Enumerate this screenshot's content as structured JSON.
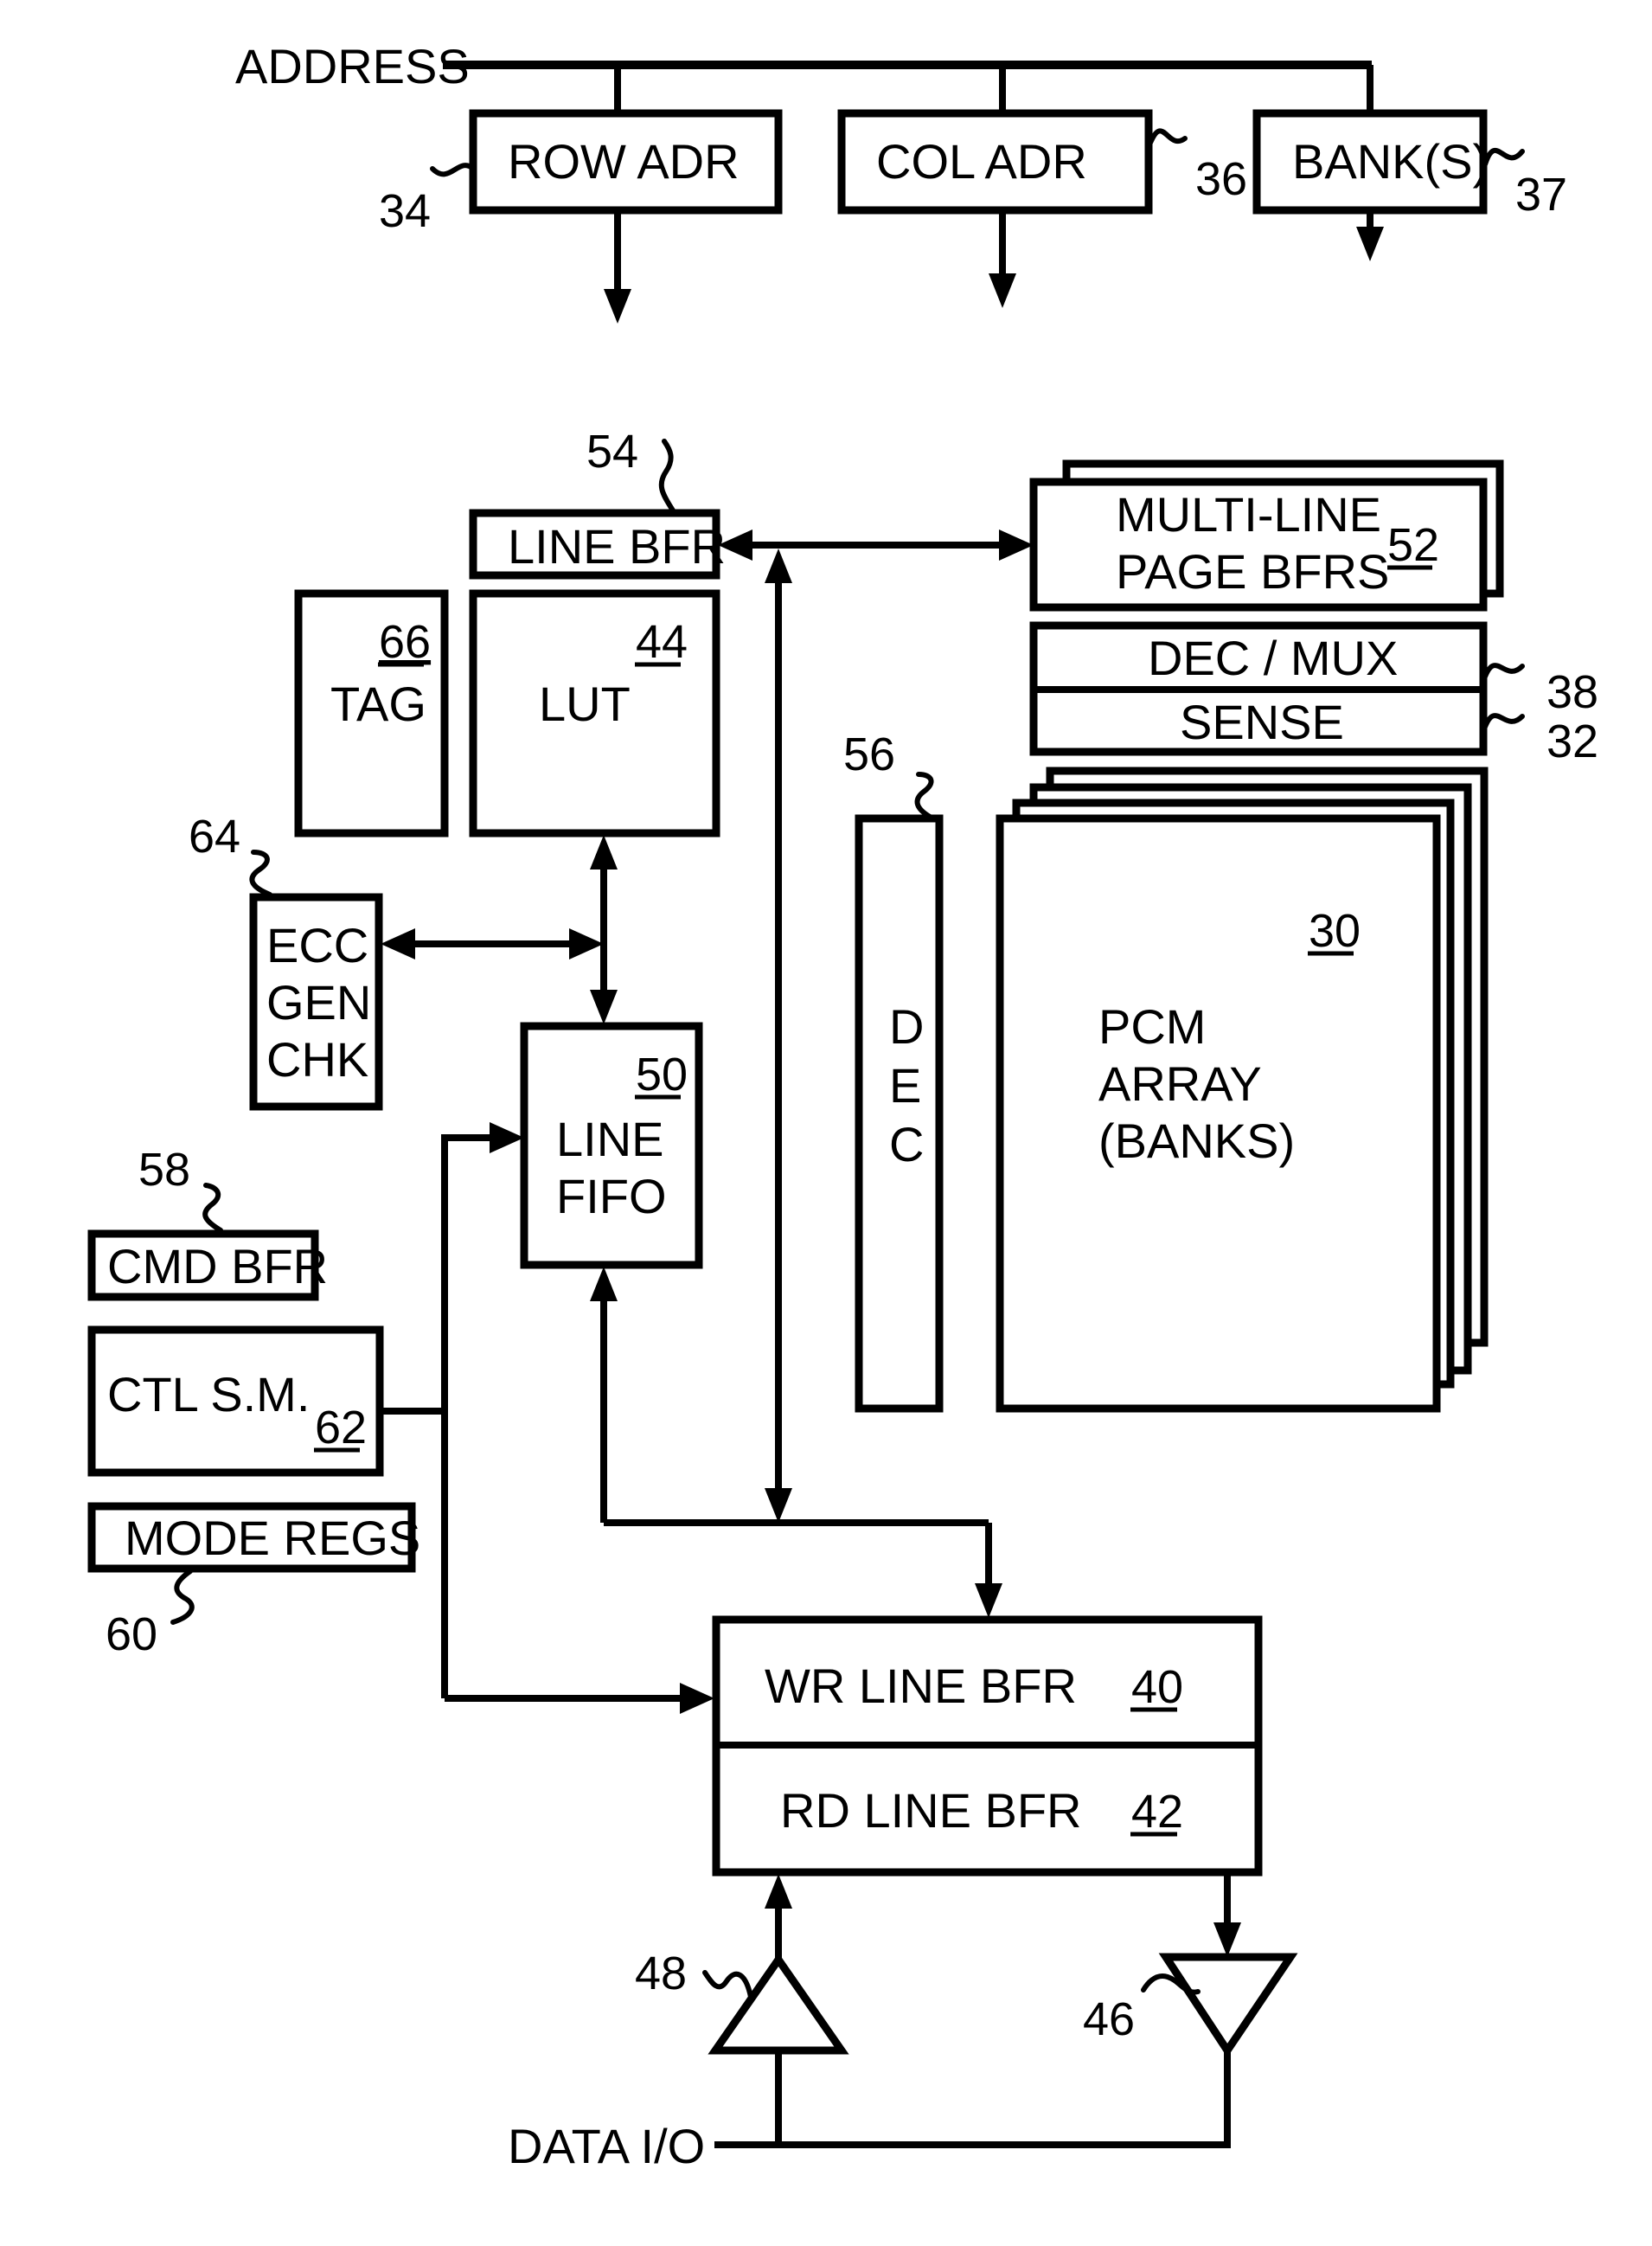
{
  "figure": {
    "address_label": "ADDRESS",
    "data_io_label": "DATA I/O",
    "blocks": {
      "row_adr": {
        "label": "ROW ADR",
        "ref": "34"
      },
      "col_adr": {
        "label": "COL ADR",
        "ref": "36"
      },
      "banks": {
        "label": "BANK(S)",
        "ref": "37"
      },
      "line_bfr": {
        "label": "LINE BFR",
        "ref": "54"
      },
      "multi_line": {
        "label_line1": "MULTI-LINE",
        "label_line2": "PAGE BFRS",
        "ref": "52"
      },
      "dec_mux": {
        "label": "DEC / MUX",
        "ref": "38"
      },
      "sense": {
        "label": "SENSE",
        "ref": "32"
      },
      "tag": {
        "label": "TAG",
        "ref": "66"
      },
      "lut": {
        "label": "LUT",
        "ref": "44"
      },
      "dec": {
        "letters": [
          "D",
          "E",
          "C"
        ],
        "ref": "56"
      },
      "pcm_array": {
        "label_line1": "PCM",
        "label_line2": "ARRAY",
        "label_line3": "(BANKS)",
        "ref": "30"
      },
      "ecc": {
        "label_line1": "ECC",
        "label_line2": "GEN",
        "label_line3": "CHK",
        "ref": "64"
      },
      "line_fifo": {
        "label_line1": "LINE",
        "label_line2": "FIFO",
        "ref": "50"
      },
      "cmd_bfr": {
        "label": "CMD BFR",
        "ref": "58"
      },
      "ctl_sm": {
        "label": "CTL S.M.",
        "ref": "62"
      },
      "mode_regs": {
        "label": "MODE REGS",
        "ref": "60"
      },
      "wr_line_bfr": {
        "label": "WR LINE BFR",
        "ref": "40"
      },
      "rd_line_bfr": {
        "label": "RD LINE BFR",
        "ref": "42"
      },
      "input_driver": {
        "ref": "48"
      },
      "output_driver": {
        "ref": "46"
      }
    }
  }
}
